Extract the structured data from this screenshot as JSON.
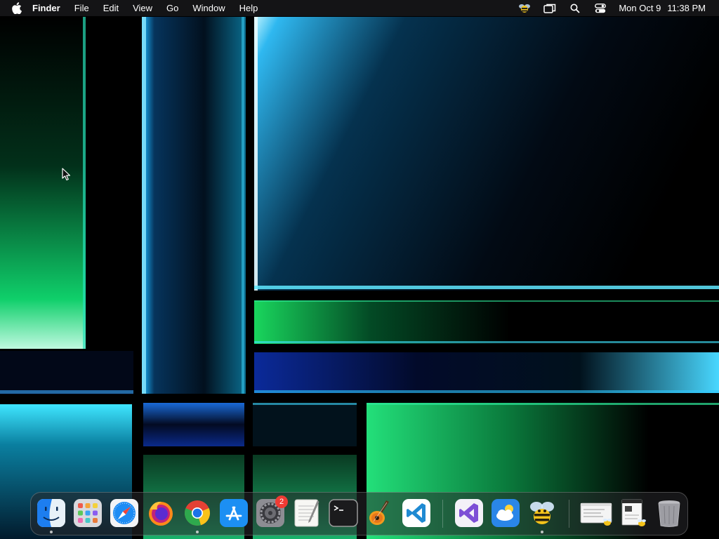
{
  "menubar": {
    "app_name": "Finder",
    "menus": [
      "File",
      "Edit",
      "View",
      "Go",
      "Window",
      "Help"
    ],
    "clock": {
      "date": "Mon Oct 9",
      "time": "11:38 PM"
    }
  },
  "dock": {
    "apps": [
      {
        "name": "Finder",
        "icon": "finder-icon",
        "running": true
      },
      {
        "name": "Launchpad",
        "icon": "launchpad-icon",
        "running": false
      },
      {
        "name": "Safari",
        "icon": "safari-icon",
        "running": false
      },
      {
        "name": "Firefox",
        "icon": "firefox-icon",
        "running": false
      },
      {
        "name": "Google Chrome",
        "icon": "chrome-icon",
        "running": true
      },
      {
        "name": "App Store",
        "icon": "app-store-icon",
        "running": false
      },
      {
        "name": "System Settings",
        "icon": "system-settings-icon",
        "running": false,
        "badge": "2"
      },
      {
        "name": "TextEdit",
        "icon": "textedit-icon",
        "running": false
      },
      {
        "name": "Terminal",
        "icon": "terminal-icon",
        "running": false
      },
      {
        "name": "GarageBand",
        "icon": "garageband-icon",
        "running": false
      },
      {
        "name": "Visual Studio Code",
        "icon": "vscode-icon",
        "running": false
      },
      {
        "name": "Visual Studio",
        "icon": "visual-studio-icon",
        "running": false
      },
      {
        "name": "Weather",
        "icon": "weather-icon",
        "running": false
      },
      {
        "name": "Bee app",
        "icon": "bee-icon",
        "running": true
      }
    ],
    "others": [
      {
        "name": "Minimized window 1",
        "icon": "minimized-window-icon"
      },
      {
        "name": "Minimized window 2",
        "icon": "minimized-window-icon"
      },
      {
        "name": "Trash",
        "icon": "trash-icon"
      }
    ]
  },
  "colors": {
    "menubar_bg": "#161618",
    "accent_cyan": "#3fe6ff",
    "accent_green": "#19d65d",
    "badge_red": "#ef3b34"
  }
}
